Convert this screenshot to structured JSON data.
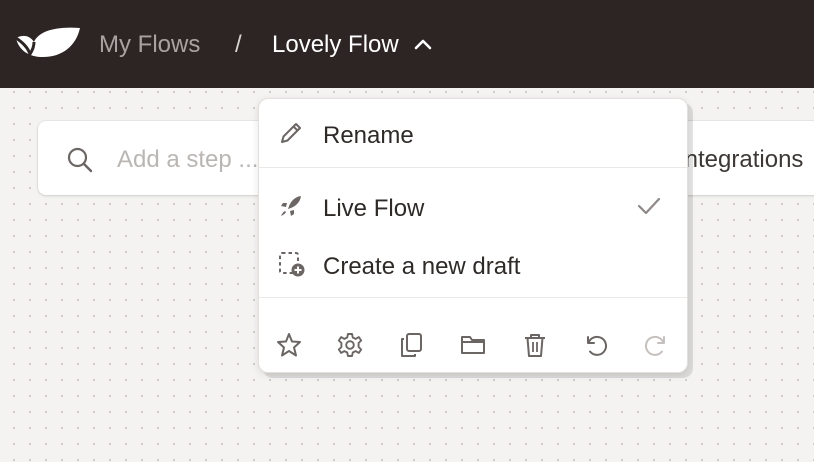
{
  "header": {
    "breadcrumb_root": "My Flows",
    "separator": "/",
    "flow_name": "Lovely Flow",
    "caret_icon": "chevron-up-icon"
  },
  "step_bar": {
    "placeholder": "Add a step ...",
    "integrations_label": "Integrations"
  },
  "flow_menu": {
    "items": [
      {
        "label": "Rename",
        "icon": "pencil-icon"
      },
      {
        "label": "Live Flow",
        "icon": "rocket-icon",
        "checked": true
      },
      {
        "label": "Create a new draft",
        "icon": "new-draft-icon"
      }
    ],
    "toolbar": [
      "star-icon",
      "gear-icon",
      "copy-icon",
      "folder-icon",
      "trash-icon",
      "undo-icon",
      "redo-icon"
    ]
  },
  "colors": {
    "header_bg": "#2d2524",
    "canvas_bg": "#f4f3f2",
    "icon": "#6b6664",
    "icon_disabled": "#c4c0be"
  }
}
